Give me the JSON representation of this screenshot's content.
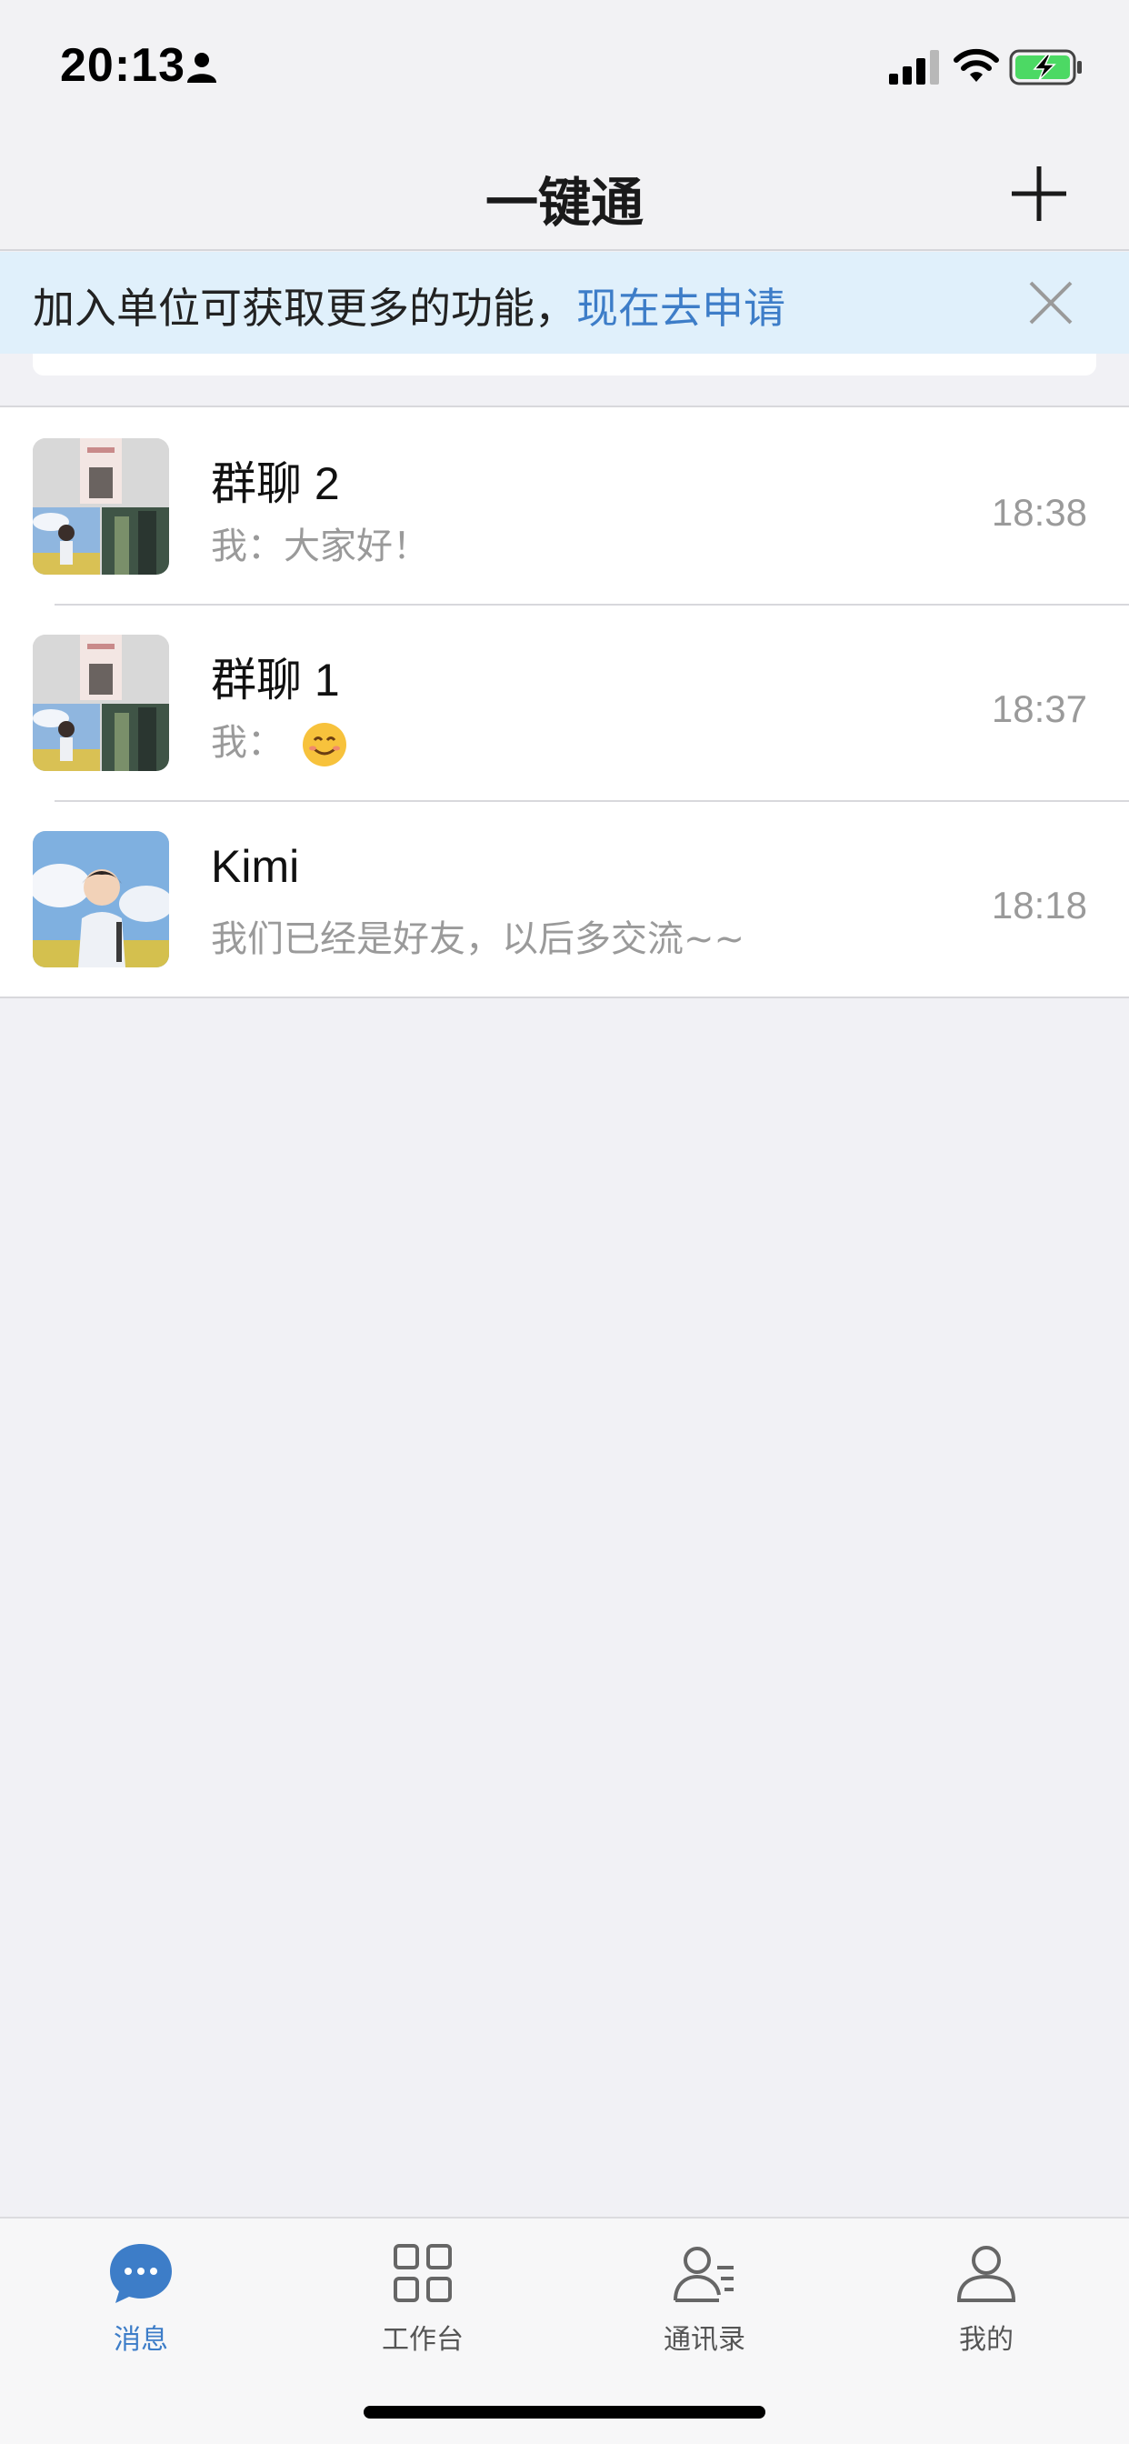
{
  "status_bar": {
    "time": "20:13",
    "icons": [
      "person-icon",
      "signal-icon",
      "wifi-icon",
      "battery-charging-icon"
    ]
  },
  "header": {
    "title": "一键通",
    "add_icon": "plus-icon"
  },
  "banner": {
    "text": "加入单位可获取更多的功能，",
    "link": "现在去申请",
    "close_icon": "close-icon"
  },
  "chats": [
    {
      "name": "群聊 2",
      "preview": "我：大家好！",
      "time": "18:38",
      "avatar": "group-avatar"
    },
    {
      "name": "群聊 1",
      "preview": "我：",
      "preview_emoji": "smiling-face-emoji",
      "time": "18:37",
      "avatar": "group-avatar"
    },
    {
      "name": "Kimi",
      "preview": "我们已经是好友，以后多交流~~",
      "time": "18:18",
      "avatar": "anime-boy-avatar"
    }
  ],
  "tabs": [
    {
      "label": "消息",
      "icon": "chat-bubble-icon",
      "active": true
    },
    {
      "label": "工作台",
      "icon": "grid-icon",
      "active": false
    },
    {
      "label": "通讯录",
      "icon": "contacts-icon",
      "active": false
    },
    {
      "label": "我的",
      "icon": "profile-icon",
      "active": false
    }
  ],
  "colors": {
    "accent": "#3d7dc8",
    "banner_bg": "#e0f0fb",
    "background": "#f1f1f5"
  }
}
